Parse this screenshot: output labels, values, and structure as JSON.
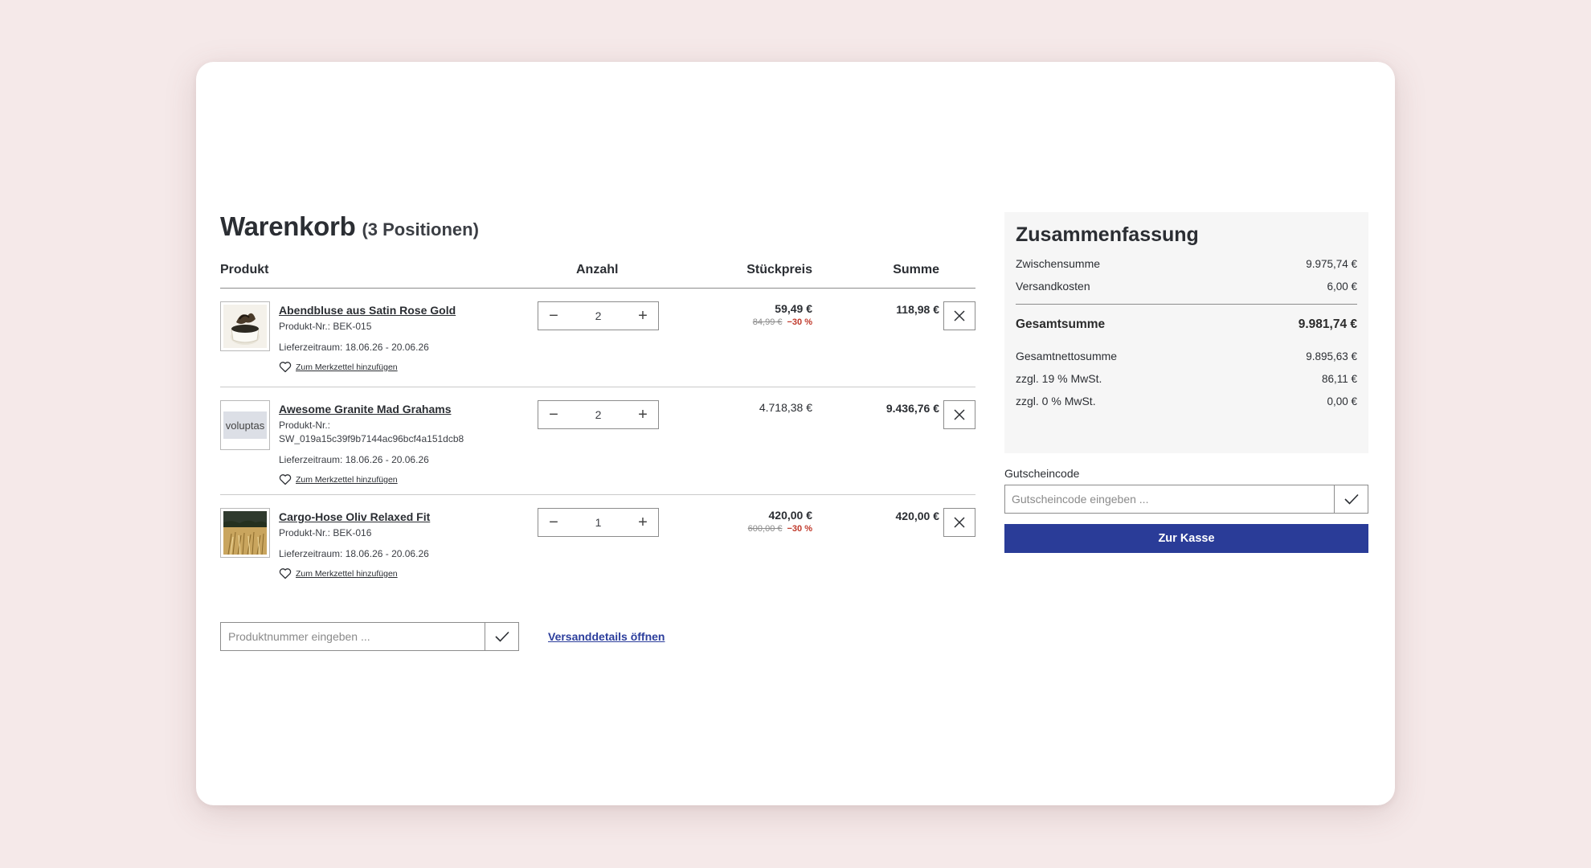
{
  "cart": {
    "title": "Warenkorb",
    "count": "(3 Positionen)",
    "headers": {
      "product": "Produkt",
      "quantity": "Anzahl",
      "unit_price": "Stückpreis",
      "total": "Summe"
    },
    "items": [
      {
        "name": "Abendbluse aus Satin Rose Gold",
        "number": "Produkt-Nr.: BEK-015",
        "delivery": "Lieferzeitraum: 18.06.26 - 20.06.26",
        "wishlist": "Zum Merkzettel hinzufügen",
        "quantity": "2",
        "unit_price": "59,49 €",
        "old_price": "84,99 €",
        "discount": "−30 %",
        "total": "118,98 €"
      },
      {
        "name": "Awesome Granite Mad Grahams",
        "number_label": "Produkt-Nr.:",
        "number_value": "SW_019a15c39f9b7144ac96bcf4a151dcb8",
        "thumb_text": "voluptas",
        "delivery": "Lieferzeitraum: 18.06.26 - 20.06.26",
        "wishlist": "Zum Merkzettel hinzufügen",
        "quantity": "2",
        "unit_price": "4.718,38 €",
        "total": "9.436,76 €"
      },
      {
        "name": "Cargo-Hose Oliv Relaxed Fit",
        "number": "Produkt-Nr.: BEK-016",
        "delivery": "Lieferzeitraum: 18.06.26 - 20.06.26",
        "wishlist": "Zum Merkzettel hinzufügen",
        "quantity": "1",
        "unit_price": "420,00 €",
        "old_price": "600,00 €",
        "discount": "−30 %",
        "total": "420,00 €"
      }
    ],
    "product_number_placeholder": "Produktnummer eingeben ...",
    "shipping_link": "Versanddetails öffnen"
  },
  "summary": {
    "title": "Zusammenfassung",
    "subtotal_label": "Zwischensumme",
    "subtotal": "9.975,74 €",
    "shipping_label": "Versandkosten",
    "shipping": "6,00 €",
    "grand_total_label": "Gesamtsumme",
    "grand_total": "9.981,74 €",
    "net_total_label": "Gesamtnettosumme",
    "net_total": "9.895,63 €",
    "vat19_label": "zzgl. 19 % MwSt.",
    "vat19": "86,11 €",
    "vat0_label": "zzgl. 0 % MwSt.",
    "vat0": "0,00 €"
  },
  "voucher": {
    "label": "Gutscheincode",
    "placeholder": "Gutscheincode eingeben ...",
    "checkout": "Zur Kasse"
  },
  "colors": {
    "accent": "#2a3c98",
    "discount": "#c0392b",
    "background": "#f5e9e9"
  },
  "icons": {
    "minus": "minus-icon",
    "plus": "plus-icon",
    "remove": "close-icon",
    "wishlist": "heart-icon",
    "submit": "checkmark-icon"
  }
}
